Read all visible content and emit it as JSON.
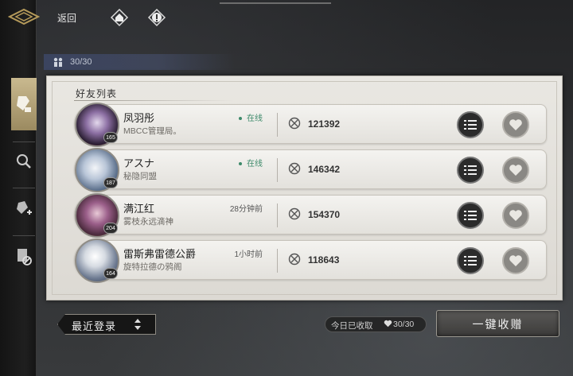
{
  "header": {
    "back_label": "返回",
    "icons": [
      "home-icon",
      "info-icon"
    ]
  },
  "friend_count": "30/30",
  "panel": {
    "title": "好友列表"
  },
  "friends": [
    {
      "name": "凤羽彤",
      "guild": "MBCC管理局。",
      "status": "在线",
      "online": true,
      "level": "165",
      "uid": "121392"
    },
    {
      "name": "アスナ",
      "guild": "秘隐同盟",
      "status": "在线",
      "online": true,
      "level": "187",
      "uid": "146342"
    },
    {
      "name": "满江红",
      "guild": "雾枝永远滴神",
      "status": "28分钟前",
      "online": false,
      "level": "204",
      "uid": "154370"
    },
    {
      "name": "雷斯弗雷德公爵",
      "guild": "旋特拉德の鸦阁",
      "status": "1小时前",
      "online": false,
      "level": "164",
      "uid": "118643"
    }
  ],
  "footer": {
    "sort_label": "最近登录",
    "received_label": "今日已收取",
    "received_count": "30/30",
    "collect_button": "一键收赠"
  },
  "colors": {
    "online": "#3d8a6a",
    "panel_bg": "#e9e7e2",
    "rail_active": "#c9b98f"
  }
}
